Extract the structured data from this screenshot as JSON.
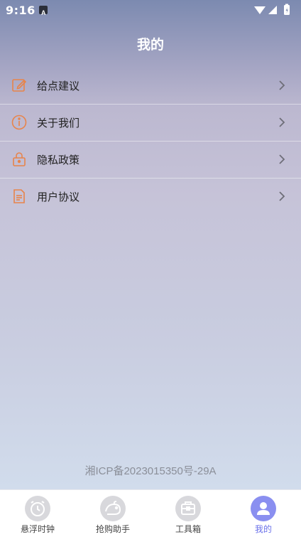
{
  "status": {
    "time": "9:16"
  },
  "header": {
    "title": "我的"
  },
  "menu": [
    {
      "label": "给点建议",
      "icon": "edit-icon"
    },
    {
      "label": "关于我们",
      "icon": "info-icon"
    },
    {
      "label": "隐私政策",
      "icon": "lock-icon"
    },
    {
      "label": "用户协议",
      "icon": "document-icon"
    }
  ],
  "footer": {
    "icp": "湘ICP备2023015350号-29A"
  },
  "tabs": [
    {
      "label": "悬浮时钟",
      "icon": "alarm-clock-icon",
      "active": false
    },
    {
      "label": "抢购助手",
      "icon": "mouse-icon",
      "active": false
    },
    {
      "label": "工具箱",
      "icon": "toolbox-icon",
      "active": false
    },
    {
      "label": "我的",
      "icon": "user-icon",
      "active": true
    }
  ],
  "colors": {
    "accent": "#6b71ea",
    "menu_icon": "#e8844a"
  }
}
